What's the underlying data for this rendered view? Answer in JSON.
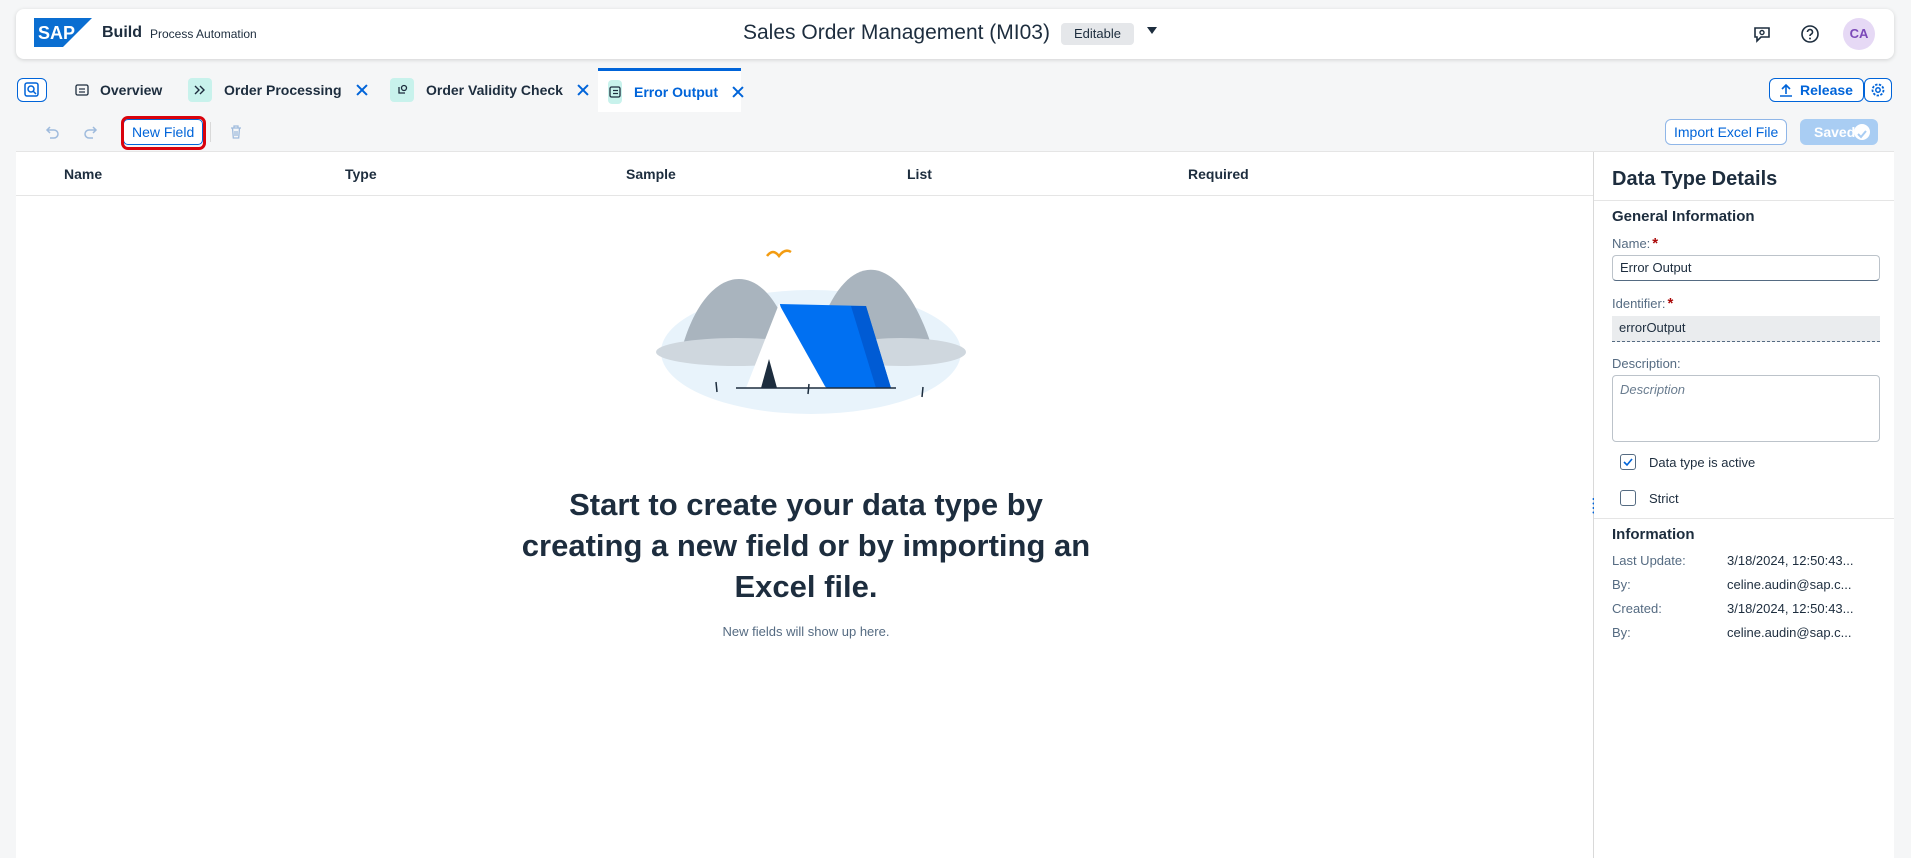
{
  "shell": {
    "brand": "SAP",
    "product": "Build",
    "product_sub": "Process Automation",
    "title": "Sales Order Management (MI03)",
    "status_badge": "Editable",
    "avatar_initials": "CA"
  },
  "tabs": [
    {
      "label": "Overview",
      "icon": "overview-icon",
      "closable": false,
      "active": false
    },
    {
      "label": "Order Processing",
      "icon": "process-icon",
      "closable": true,
      "active": false
    },
    {
      "label": "Order Validity Check",
      "icon": "decision-icon",
      "closable": true,
      "active": false
    },
    {
      "label": "Error Output",
      "icon": "data-type-icon",
      "closable": true,
      "active": true
    }
  ],
  "tabbar": {
    "release_label": "Release"
  },
  "toolbar": {
    "new_field_label": "New Field",
    "import_label": "Import Excel File",
    "saved_label": "Saved"
  },
  "table": {
    "columns": [
      "Name",
      "Type",
      "Sample",
      "List",
      "Required"
    ]
  },
  "empty_state": {
    "title": "Start to create your data type by creating a new field or by importing an Excel file.",
    "subtitle": "New fields will show up here."
  },
  "details": {
    "title": "Data Type Details",
    "general_heading": "General Information",
    "name_label": "Name:",
    "name_value": "Error Output",
    "identifier_label": "Identifier:",
    "identifier_value": "errorOutput",
    "description_label": "Description:",
    "description_placeholder": "Description",
    "active_label": "Data type is active",
    "active_checked": true,
    "strict_label": "Strict",
    "strict_checked": false,
    "info_heading": "Information",
    "info": [
      {
        "key": "Last Update:",
        "value": "3/18/2024, 12:50:43..."
      },
      {
        "key": "By:",
        "value": "celine.audin@sap.c..."
      },
      {
        "key": "Created:",
        "value": "3/18/2024, 12:50:43..."
      },
      {
        "key": "By:",
        "value": "celine.audin@sap.c..."
      }
    ]
  },
  "colors": {
    "accent": "#0064d9",
    "highlight": "#d9030d",
    "tab_icon_bg": "#c8f2ec"
  }
}
